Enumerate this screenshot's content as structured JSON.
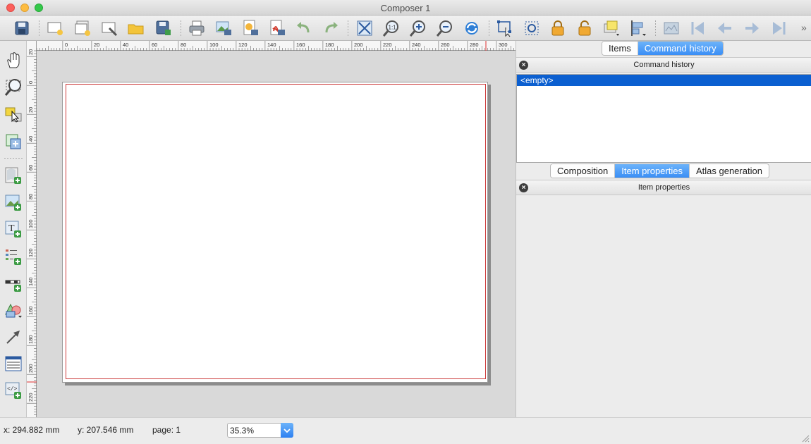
{
  "window": {
    "title": "Composer 1"
  },
  "toolbar": {
    "icons": [
      "save-icon",
      "new-composer-icon",
      "duplicate-composer-icon",
      "composer-manager-icon",
      "load-template-icon",
      "save-template-icon",
      "print-icon",
      "export-image-icon",
      "export-svg-icon",
      "export-pdf-icon",
      "undo-icon",
      "redo-icon",
      "zoom-full-icon",
      "zoom-actual-icon",
      "zoom-in-icon",
      "zoom-out-icon",
      "refresh-icon",
      "select-icon",
      "move-content-icon",
      "lock-icon",
      "unlock-icon",
      "raise-icon",
      "align-icon",
      "atlas-preview-icon",
      "first-feature-icon",
      "previous-feature-icon",
      "next-feature-icon",
      "last-feature-icon"
    ],
    "more": "»"
  },
  "ruler": {
    "h_labels": [
      "0",
      "20",
      "40",
      "60",
      "80",
      "100",
      "120",
      "140",
      "160",
      "180",
      "200",
      "220",
      "240",
      "260",
      "280",
      "300"
    ],
    "v_labels": [
      "20",
      "0",
      "20",
      "40",
      "60",
      "80",
      "100",
      "120",
      "140",
      "160",
      "180",
      "200",
      "220"
    ]
  },
  "dock": {
    "top_tabs": [
      "Items",
      "Command history"
    ],
    "command_history_title": "Command history",
    "history_items": [
      "<empty>"
    ],
    "bottom_tabs": [
      "Composition",
      "Item properties",
      "Atlas generation"
    ],
    "item_properties_title": "Item properties"
  },
  "status": {
    "x": "x: 294.882 mm",
    "y": "y: 207.546 mm",
    "page": "page: 1",
    "zoom": "35.3%"
  },
  "colors": {
    "accent": "#3a8ef5",
    "selection": "#0b5fd0",
    "page_margin": "#cc3a3a"
  }
}
